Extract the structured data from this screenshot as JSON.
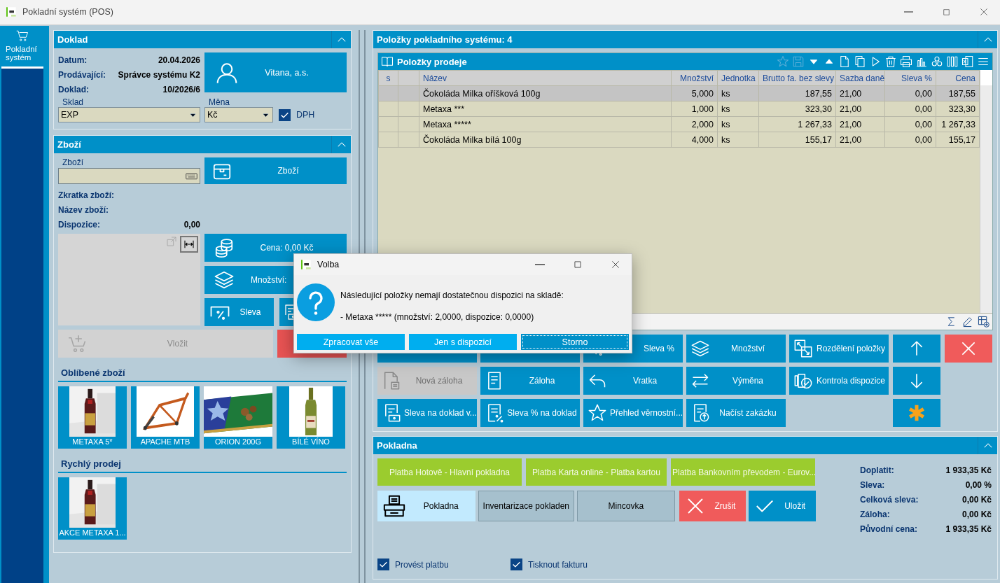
{
  "window": {
    "title": "Pokladní systém (POS)"
  },
  "nav": [
    {
      "label": "Pokladní systém",
      "selected": true
    }
  ],
  "doklad": {
    "title": "Doklad",
    "fields": [
      {
        "label": "Datum:",
        "value": "20.04.2026"
      },
      {
        "label": "Prodávající:",
        "value": "Správce systému K2"
      },
      {
        "label": "Doklad:",
        "value": "10/2026/6"
      }
    ],
    "customer": "Vitana, a.s.",
    "sklad": {
      "label": "Sklad",
      "value": "EXP"
    },
    "mena": {
      "label": "Měna",
      "value": "Kč"
    },
    "dph": {
      "label": "DPH",
      "checked": true
    }
  },
  "zbozi": {
    "title": "Zboží",
    "field": {
      "label": "Zboží"
    },
    "button": "Zboží",
    "info": [
      {
        "label": "Zkratka zboží:"
      },
      {
        "label": "Název zboží:"
      },
      {
        "label": "Dispozice:",
        "value": "0,00"
      }
    ],
    "price_button": "Cena: 0,00 Kč",
    "quantity_button": "Množství:",
    "discount_button": "Sleva",
    "insert_button": {
      "label": "Vložit",
      "disabled": true
    },
    "favorites": {
      "title": "Oblíbené zboží",
      "items": [
        {
          "label": "METAXA 5*"
        },
        {
          "label": "APACHE MTB"
        },
        {
          "label": "ORION 200G"
        },
        {
          "label": "BÍLÉ VÍNO"
        }
      ]
    },
    "quick_sale": {
      "title": "Rychlý prodej",
      "items": [
        {
          "label": "AKCE METAXA 1..."
        }
      ]
    }
  },
  "items_panel": {
    "title": "Položky pokladního systému: 4",
    "grid": {
      "title": "Položky prodeje",
      "columns": [
        "s",
        "Název",
        "Množství",
        "Jednotka",
        "Brutto fa. bez slevy",
        "Sazba daně",
        "Sleva %",
        "Cena"
      ],
      "rows": [
        {
          "name": "Čokoláda Milka oříšková 100g",
          "quantity": "5,000",
          "unit": "ks",
          "gross": "187,55",
          "vat": "21,00",
          "discount": "0,00",
          "price": "187,55",
          "selected": true
        },
        {
          "name": "Metaxa ***",
          "quantity": "1,000",
          "unit": "ks",
          "gross": "323,30",
          "vat": "21,00",
          "discount": "0,00",
          "price": "323,30",
          "selected": false
        },
        {
          "name": "Metaxa *****",
          "quantity": "2,000",
          "unit": "ks",
          "gross": "1 267,33",
          "vat": "21,00",
          "discount": "0,00",
          "price": "1 267,33",
          "selected": false
        },
        {
          "name": "Čokoláda Milka bílá 100g",
          "quantity": "4,000",
          "unit": "ks",
          "gross": "155,17",
          "vat": "21,00",
          "discount": "0,00",
          "price": "155,17",
          "selected": false
        }
      ]
    },
    "actions": [
      {
        "kind": "covered",
        "disabled": false
      },
      {
        "kind": "covered",
        "disabled": false
      },
      {
        "kind": "discount_percent",
        "label": "Sleva %",
        "disabled": false
      },
      {
        "kind": "quantity",
        "label": "Množství",
        "disabled": false
      },
      {
        "kind": "split",
        "label": "Rozdělení položky",
        "disabled": false
      },
      {
        "kind": "new_deposit",
        "label": "Nová záloha",
        "disabled": true
      },
      {
        "kind": "deposit",
        "label": "Záloha",
        "disabled": false
      },
      {
        "kind": "return",
        "label": "Vratka",
        "disabled": false
      },
      {
        "kind": "exchange",
        "label": "Výměna",
        "disabled": false
      },
      {
        "kind": "check_stock",
        "label": "Kontrola dispozice",
        "disabled": false
      },
      {
        "kind": "doc_discount",
        "label": "Sleva na doklad v...",
        "disabled": false
      },
      {
        "kind": "doc_discount_percent",
        "label": "Sleva % na doklad",
        "disabled": false
      },
      {
        "kind": "loyalty",
        "label": "Přehled věrnostní...",
        "disabled": false
      },
      {
        "kind": "load_order",
        "label": "Načíst zakázku",
        "disabled": false
      }
    ],
    "side_actions": [
      {
        "kind": "up"
      },
      {
        "kind": "delete"
      },
      {
        "kind": "down"
      },
      {
        "kind": "special"
      }
    ]
  },
  "pokladna": {
    "title": "Pokladna",
    "payments": [
      "Platba Hotově - Hlavní pokladna",
      "Platba Karta online - Platba kartou",
      "Platba Bankovním převodem - Eurov..."
    ],
    "modes": [
      {
        "label": "Pokladna",
        "selected": true
      },
      {
        "label": "Inventarizace pokladen",
        "selected": false
      },
      {
        "label": "Mincovka",
        "selected": false
      }
    ],
    "commands": [
      {
        "kind": "cancel",
        "label": "Zrušit"
      },
      {
        "kind": "save",
        "label": "Uložit"
      }
    ],
    "summary": [
      {
        "label": "Doplatit:",
        "value": "1 933,35 Kč"
      },
      {
        "label": "Sleva:",
        "value": "0,00 %"
      },
      {
        "label": "Celková sleva:",
        "value": "0,00 Kč"
      },
      {
        "label": "Záloha:",
        "value": "0,00 Kč"
      },
      {
        "label": "Původní cena:",
        "value": "1 933,35 Kč"
      }
    ],
    "options": [
      {
        "label": "Provést platbu",
        "checked": true
      },
      {
        "label": "Tisknout fakturu",
        "checked": true
      }
    ]
  },
  "dialog": {
    "title": "Volba",
    "message": "Následující položky nemají dostatečnou dispozici na skladě:",
    "detail": "- Metaxa ***** (množství: 2,0000, dispozice: 0,0000)",
    "buttons": [
      {
        "label": "Zpracovat vše",
        "focused": false
      },
      {
        "label": "Jen s dispozicí",
        "focused": false
      },
      {
        "label": "Storno",
        "focused": true
      }
    ]
  }
}
